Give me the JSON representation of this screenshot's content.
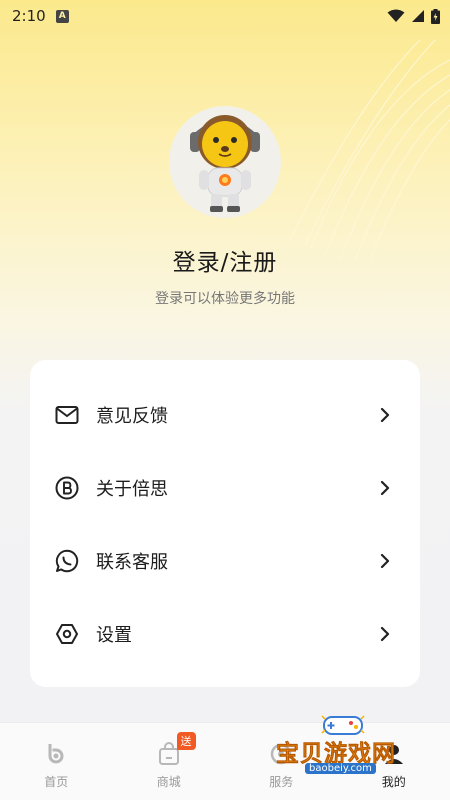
{
  "status_bar": {
    "time": "2:10",
    "notification_letter": "A"
  },
  "profile": {
    "title": "登录/注册",
    "subtitle": "登录可以体验更多功能"
  },
  "menu": {
    "items": [
      {
        "label": "意见反馈",
        "icon": "mail-icon"
      },
      {
        "label": "关于倍思",
        "icon": "brand-b-icon"
      },
      {
        "label": "联系客服",
        "icon": "chat-icon"
      },
      {
        "label": "设置",
        "icon": "settings-icon"
      }
    ]
  },
  "bottom_nav": {
    "items": [
      {
        "label": "首页",
        "icon": "home-icon"
      },
      {
        "label": "商城",
        "icon": "shopping-bag-icon",
        "badge": "送"
      },
      {
        "label": "服务",
        "icon": "service-icon"
      },
      {
        "label": "我的",
        "icon": "profile-icon"
      }
    ],
    "active": "我的"
  },
  "watermark": {
    "text": "宝贝游戏网",
    "url": "baobeiy.com"
  },
  "colors": {
    "accent": "#f15a24",
    "header_yellow": "#fbe98c",
    "watermark_orange": "#ff9a1f"
  }
}
